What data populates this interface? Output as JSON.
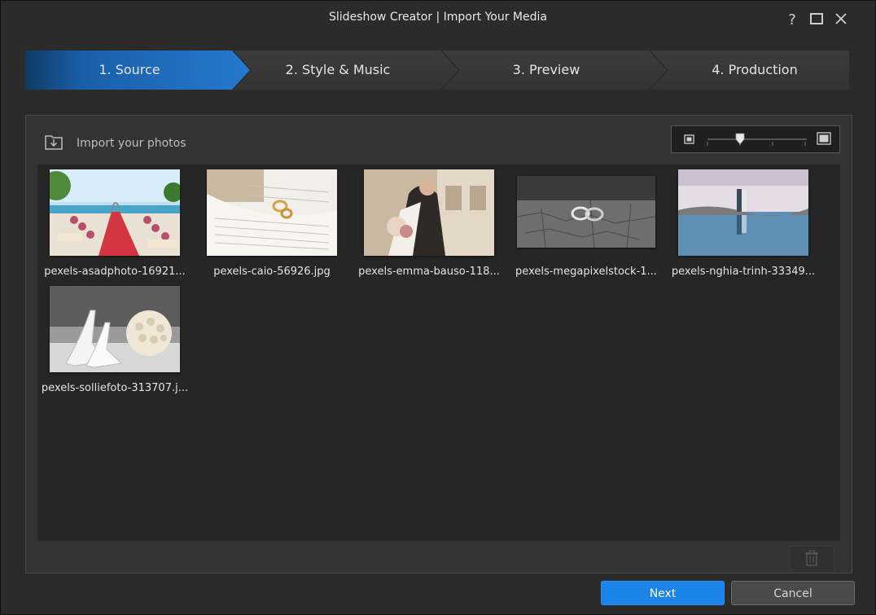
{
  "window": {
    "title": "Slideshow Creator | Import Your Media",
    "help_icon": "help-icon",
    "maximize_icon": "maximize-icon",
    "close_icon": "close-icon"
  },
  "steps": [
    {
      "label": "1. Source",
      "active": true
    },
    {
      "label": "2. Style & Music",
      "active": false
    },
    {
      "label": "3. Preview",
      "active": false
    },
    {
      "label": "4. Production",
      "active": false
    }
  ],
  "toolbar": {
    "import_label": "Import your photos",
    "import_icon": "import-folder-icon"
  },
  "media": [
    {
      "name": "pexels-asadphoto-16921..."
    },
    {
      "name": "pexels-caio-56926.jpg"
    },
    {
      "name": "pexels-emma-bauso-118..."
    },
    {
      "name": "pexels-megapixelstock-1..."
    },
    {
      "name": "pexels-nghia-trinh-33349..."
    },
    {
      "name": "pexels-solliefoto-313707.j..."
    }
  ],
  "actions": {
    "next_label": "Next",
    "cancel_label": "Cancel",
    "delete_icon": "trash-icon"
  },
  "colors": {
    "accent": "#1a84e8",
    "active_step": "#1e6cc0",
    "background": "#2b2b2b"
  }
}
